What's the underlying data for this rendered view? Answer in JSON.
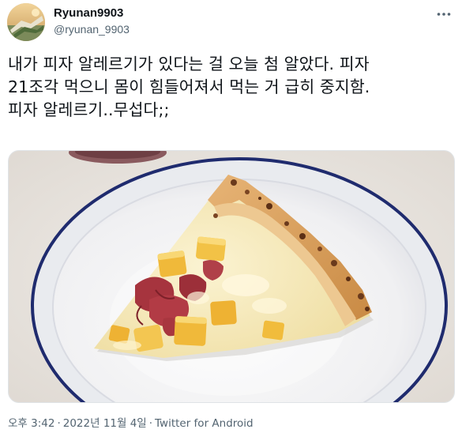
{
  "user": {
    "display_name": "Ryunan9903",
    "handle": "@ryunan_9903"
  },
  "more_icon": "ellipsis-icon",
  "tweet": {
    "lines": [
      "내가 피자 알레르기가 있다는 걸 오늘 첨 알았다. 피자",
      "21조각 먹으니 몸이 힘들어져서 먹는 거 급히 중지함.",
      "피자 알레르기..무섭다;;"
    ]
  },
  "media": {
    "icon": "pizza-slice-photo"
  },
  "meta": {
    "time": "오후 3:42",
    "separator": "·",
    "date": "2022년 11월 4일",
    "source": "Twitter for Android"
  },
  "colors": {
    "text": "#0f1419",
    "muted": "#536471",
    "plate_rim": "#1f2b6e",
    "crust": "#d99a4e",
    "cheese": "#f3e7b4",
    "pineapple": "#f0b93a",
    "ham": "#a6343e"
  }
}
